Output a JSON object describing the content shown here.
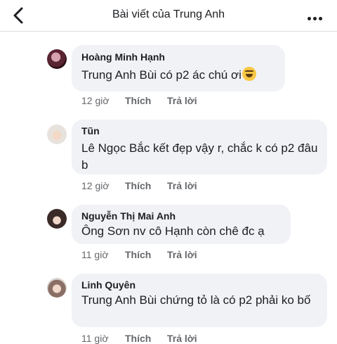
{
  "header": {
    "title": "Bài viết của Trung Anh",
    "back_icon": "chevron-left-icon",
    "more_icon": "more-dots-icon"
  },
  "comments": [
    {
      "author": "Hoàng Minh Hạnh",
      "text": "Trung Anh Bùi có p2 ác chú ơi",
      "emoji": "laughing-face-emoji",
      "time": "12 giờ",
      "like": "Thích",
      "reply": "Trả lời"
    },
    {
      "author": "Tũn",
      "text": "Lê Ngọc Bắc kết đẹp vậy r, chắc k có p2 đâu b",
      "time": "12 giờ",
      "like": "Thích",
      "reply": "Trả lời"
    },
    {
      "author": "Nguyễn Thị Mai Anh",
      "text": "Ông Sơn nv cô Hạnh còn chê đc ạ",
      "time": "11 giờ",
      "like": "Thích",
      "reply": "Trả lời"
    },
    {
      "author": "Linh Quyên",
      "text": "Trung Anh Bùi chứng tỏ là có p2 phải ko bố",
      "time": "11 giờ",
      "like": "Thích",
      "reply": "Trả lời"
    }
  ]
}
